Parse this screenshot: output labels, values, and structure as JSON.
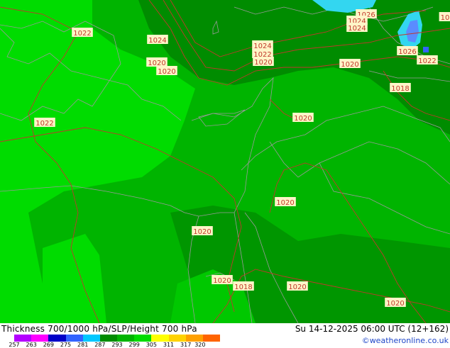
{
  "map": {
    "pressure_labels": [
      "1022",
      "1024",
      "1020",
      "1022",
      "1020",
      "1022",
      "1026",
      "1024",
      "1026",
      "1022",
      "1024",
      "1022",
      "1020",
      "1020",
      "1018",
      "1020",
      "1020",
      "1020",
      "1020",
      "1018",
      "1020",
      "1020",
      "1026",
      "1022",
      "10"
    ],
    "colors": {
      "thickness_light": "#00dc00",
      "thickness_medium": "#00b400",
      "thickness_dark": "#008c00",
      "thickness_cold": "#00c800",
      "sea_level_lines": "#c0392b",
      "coastline": "#9a9a9a",
      "cyan_high": "#33d6f0",
      "blue_high": "#5a8cff"
    }
  },
  "footer": {
    "title": "Thickness 700/1000 hPa/SLP/Height 700 hPa",
    "datetime": "Su 14-12-2025 06:00 UTC (12+162)",
    "credit": "©weatheronline.co.uk",
    "legend": {
      "ticks": [
        "257",
        "263",
        "269",
        "275",
        "281",
        "287",
        "293",
        "299",
        "305",
        "311",
        "317",
        "320"
      ],
      "colors": [
        "#b400ff",
        "#ff00ff",
        "#0000c8",
        "#3264ff",
        "#00c8ff",
        "#008c00",
        "#00b400",
        "#00dc00",
        "#ffff00",
        "#ffd200",
        "#ffa000",
        "#ff6400"
      ]
    }
  }
}
